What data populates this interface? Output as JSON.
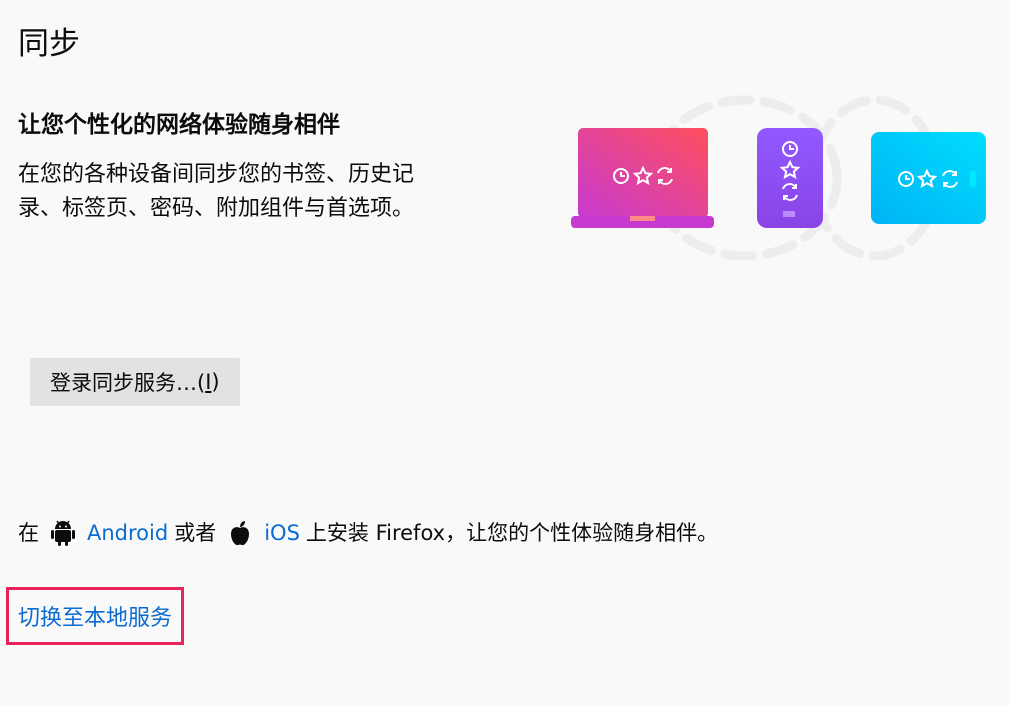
{
  "section": {
    "title": "同步",
    "heading": "让您个性化的网络体验随身相伴",
    "description": "在您的各种设备间同步您的书签、历史记录、标签页、密码、附加组件与首选项。"
  },
  "signin": {
    "label": "登录同步服务…(",
    "accesskey": "I",
    "close": ")"
  },
  "install": {
    "prefix": "在",
    "android_label": "Android",
    "middle": "或者",
    "ios_label": "iOS",
    "suffix": "上安装 Firefox，让您的个性体验随身相伴。"
  },
  "switch_link": "切换至本地服务",
  "colors": {
    "link": "#0a6bd0",
    "highlight_border": "#e7245a",
    "button_bg": "#e2e2e5"
  },
  "icons": {
    "android": "android-icon",
    "apple": "apple-icon",
    "history": "clock-icon",
    "bookmark": "star-icon",
    "sync": "sync-icon"
  }
}
